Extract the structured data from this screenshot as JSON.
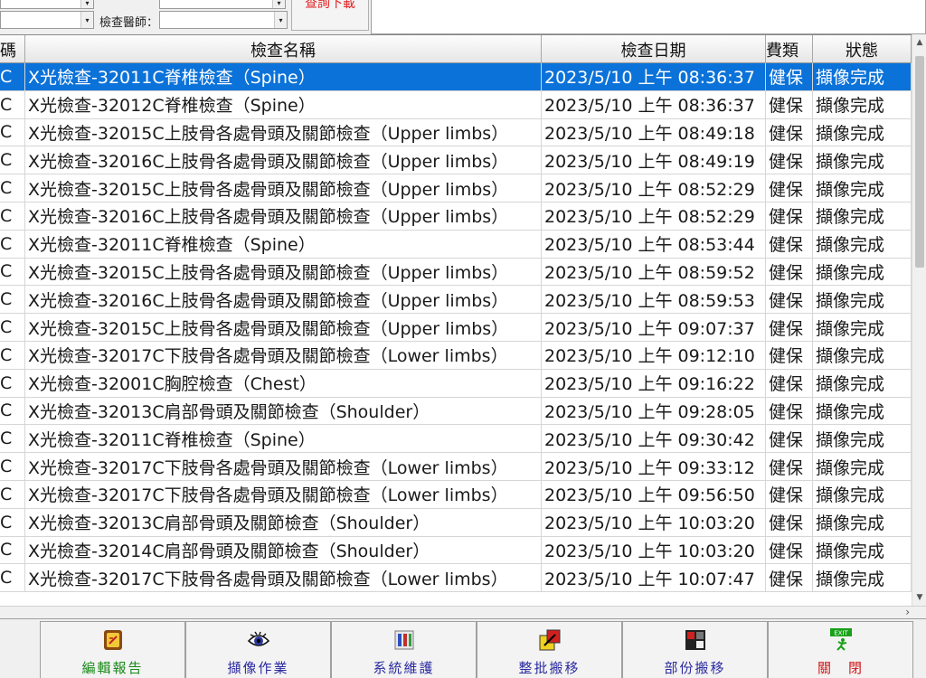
{
  "filters": {
    "doctor_label": "檢查醫師：",
    "dropdown_arrow": "▾",
    "query_button_label": "查詢下載"
  },
  "grid": {
    "headers": [
      "碼",
      "檢查名稱",
      "檢查日期",
      "費類",
      "狀態"
    ],
    "rows": [
      [
        "C",
        "X光檢查-32011C脊椎檢查（Spine）",
        "2023/5/10 上午 08:36:37",
        "健保",
        "擷像完成"
      ],
      [
        "C",
        "X光檢查-32012C脊椎檢查（Spine）",
        "2023/5/10 上午 08:36:37",
        "健保",
        "擷像完成"
      ],
      [
        "C",
        "X光檢查-32015C上肢骨各處骨頭及關節檢查（Upper limbs）",
        "2023/5/10 上午 08:49:18",
        "健保",
        "擷像完成"
      ],
      [
        "C",
        "X光檢查-32016C上肢骨各處骨頭及關節檢查（Upper limbs）",
        "2023/5/10 上午 08:49:19",
        "健保",
        "擷像完成"
      ],
      [
        "C",
        "X光檢查-32015C上肢骨各處骨頭及關節檢查（Upper limbs）",
        "2023/5/10 上午 08:52:29",
        "健保",
        "擷像完成"
      ],
      [
        "C",
        "X光檢查-32016C上肢骨各處骨頭及關節檢查（Upper limbs）",
        "2023/5/10 上午 08:52:29",
        "健保",
        "擷像完成"
      ],
      [
        "C",
        "X光檢查-32011C脊椎檢查（Spine）",
        "2023/5/10 上午 08:53:44",
        "健保",
        "擷像完成"
      ],
      [
        "C",
        "X光檢查-32015C上肢骨各處骨頭及關節檢查（Upper limbs）",
        "2023/5/10 上午 08:59:52",
        "健保",
        "擷像完成"
      ],
      [
        "C",
        "X光檢查-32016C上肢骨各處骨頭及關節檢查（Upper limbs）",
        "2023/5/10 上午 08:59:53",
        "健保",
        "擷像完成"
      ],
      [
        "C",
        "X光檢查-32015C上肢骨各處骨頭及關節檢查（Upper limbs）",
        "2023/5/10 上午 09:07:37",
        "健保",
        "擷像完成"
      ],
      [
        "C",
        "X光檢查-32017C下肢骨各處骨頭及關節檢查（Lower limbs）",
        "2023/5/10 上午 09:12:10",
        "健保",
        "擷像完成"
      ],
      [
        "C",
        "X光檢查-32001C胸腔檢查（Chest）",
        "2023/5/10 上午 09:16:22",
        "健保",
        "擷像完成"
      ],
      [
        "C",
        "X光檢查-32013C肩部骨頭及關節檢查（Shoulder）",
        "2023/5/10 上午 09:28:05",
        "健保",
        "擷像完成"
      ],
      [
        "C",
        "X光檢查-32011C脊椎檢查（Spine）",
        "2023/5/10 上午 09:30:42",
        "健保",
        "擷像完成"
      ],
      [
        "C",
        "X光檢查-32017C下肢骨各處骨頭及關節檢查（Lower limbs）",
        "2023/5/10 上午 09:33:12",
        "健保",
        "擷像完成"
      ],
      [
        "C",
        "X光檢查-32017C下肢骨各處骨頭及關節檢查（Lower limbs）",
        "2023/5/10 上午 09:56:50",
        "健保",
        "擷像完成"
      ],
      [
        "C",
        "X光檢查-32013C肩部骨頭及關節檢查（Shoulder）",
        "2023/5/10 上午 10:03:20",
        "健保",
        "擷像完成"
      ],
      [
        "C",
        "X光檢查-32014C肩部骨頭及關節檢查（Shoulder）",
        "2023/5/10 上午 10:03:20",
        "健保",
        "擷像完成"
      ],
      [
        "C",
        "X光檢查-32017C下肢骨各處骨頭及關節檢查（Lower limbs）",
        "2023/5/10 上午 10:07:47",
        "健保",
        "擷像完成"
      ]
    ],
    "selected_row_color": "#0b72d9"
  },
  "scroll": {
    "h_arrow": "›"
  },
  "toolbar": {
    "buttons": [
      {
        "label": "編輯報告",
        "icon": "edit-report-icon",
        "color": "#1a8a1a"
      },
      {
        "label": "擷像作業",
        "icon": "eye-icon",
        "color": "#2a2aa0"
      },
      {
        "label": "系統維護",
        "icon": "tools-icon",
        "color": "#2a2aa0"
      },
      {
        "label": "整批搬移",
        "icon": "batch-move-icon",
        "color": "#2a2aa0"
      },
      {
        "label": "部份搬移",
        "icon": "partial-move-icon",
        "color": "#2a2aa0"
      },
      {
        "label": "關　閉",
        "icon": "exit-icon",
        "color": "#d01818",
        "icon_text": "EXIT"
      }
    ]
  }
}
